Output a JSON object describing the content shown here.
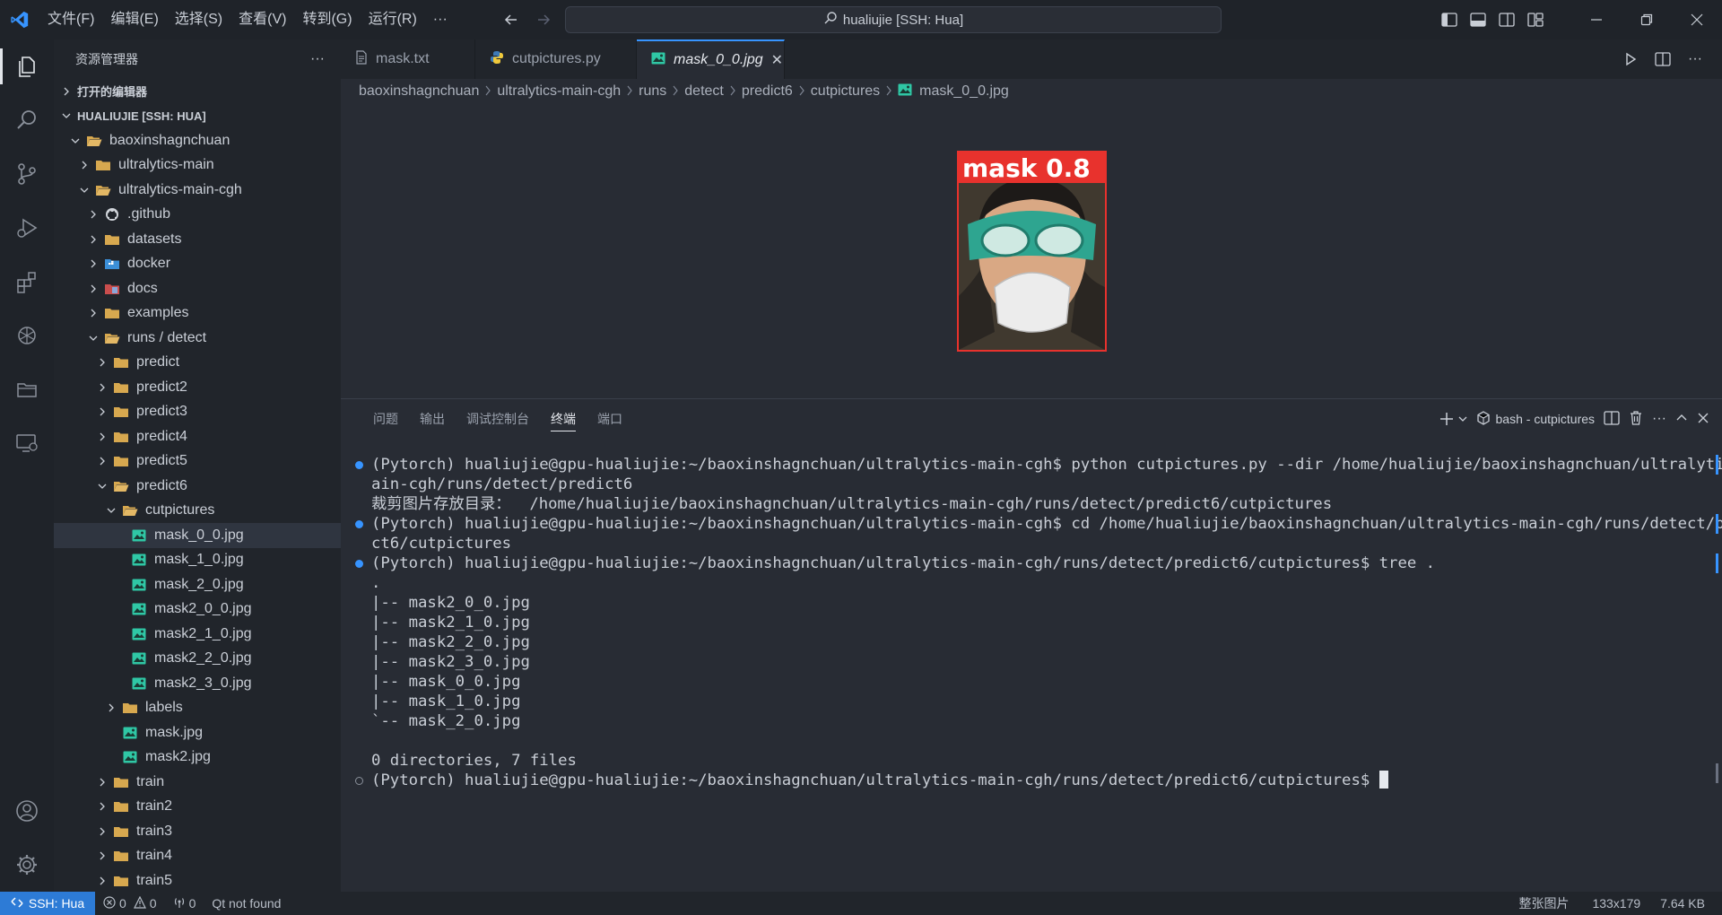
{
  "titlebar": {
    "menu": [
      "文件(F)",
      "编辑(E)",
      "选择(S)",
      "查看(V)",
      "转到(G)",
      "运行(R)",
      "···"
    ],
    "command_center": "hualiujie [SSH: Hua]"
  },
  "sidebar": {
    "title": "资源管理器",
    "more": "···",
    "open_editors": "打开的编辑器",
    "workspace": "HUALIUJIE [SSH: HUA]",
    "tree": [
      {
        "label": "baoxinshagnchuan",
        "depth": 1,
        "kind": "folder",
        "open": true
      },
      {
        "label": "ultralytics-main",
        "depth": 2,
        "kind": "folder",
        "open": false
      },
      {
        "label": "ultralytics-main-cgh",
        "depth": 2,
        "kind": "folder",
        "open": true
      },
      {
        "label": ".github",
        "depth": 3,
        "kind": "github",
        "open": false
      },
      {
        "label": "datasets",
        "depth": 3,
        "kind": "folder",
        "open": false
      },
      {
        "label": "docker",
        "depth": 3,
        "kind": "docker",
        "open": false
      },
      {
        "label": "docs",
        "depth": 3,
        "kind": "docs",
        "open": false
      },
      {
        "label": "examples",
        "depth": 3,
        "kind": "folder",
        "open": false
      },
      {
        "label": "runs / detect",
        "depth": 3,
        "kind": "folder",
        "open": true
      },
      {
        "label": "predict",
        "depth": 4,
        "kind": "folder",
        "open": false
      },
      {
        "label": "predict2",
        "depth": 4,
        "kind": "folder",
        "open": false
      },
      {
        "label": "predict3",
        "depth": 4,
        "kind": "folder",
        "open": false
      },
      {
        "label": "predict4",
        "depth": 4,
        "kind": "folder",
        "open": false
      },
      {
        "label": "predict5",
        "depth": 4,
        "kind": "folder",
        "open": false
      },
      {
        "label": "predict6",
        "depth": 4,
        "kind": "folder",
        "open": true
      },
      {
        "label": "cutpictures",
        "depth": 5,
        "kind": "folder",
        "open": true
      },
      {
        "label": "mask_0_0.jpg",
        "depth": 6,
        "kind": "image",
        "selected": true
      },
      {
        "label": "mask_1_0.jpg",
        "depth": 6,
        "kind": "image"
      },
      {
        "label": "mask_2_0.jpg",
        "depth": 6,
        "kind": "image"
      },
      {
        "label": "mask2_0_0.jpg",
        "depth": 6,
        "kind": "image"
      },
      {
        "label": "mask2_1_0.jpg",
        "depth": 6,
        "kind": "image"
      },
      {
        "label": "mask2_2_0.jpg",
        "depth": 6,
        "kind": "image"
      },
      {
        "label": "mask2_3_0.jpg",
        "depth": 6,
        "kind": "image"
      },
      {
        "label": "labels",
        "depth": 5,
        "kind": "folder",
        "open": false
      },
      {
        "label": "mask.jpg",
        "depth": 5,
        "kind": "image"
      },
      {
        "label": "mask2.jpg",
        "depth": 5,
        "kind": "image"
      },
      {
        "label": "train",
        "depth": 4,
        "kind": "folder",
        "open": false
      },
      {
        "label": "train2",
        "depth": 4,
        "kind": "folder",
        "open": false
      },
      {
        "label": "train3",
        "depth": 4,
        "kind": "folder",
        "open": false
      },
      {
        "label": "train4",
        "depth": 4,
        "kind": "folder",
        "open": false
      },
      {
        "label": "train5",
        "depth": 4,
        "kind": "folder",
        "open": false
      }
    ]
  },
  "editor": {
    "tabs": [
      {
        "label": "mask.txt",
        "icon": "text-file-icon",
        "active": false
      },
      {
        "label": "cutpictures.py",
        "icon": "python-file-icon",
        "active": false
      },
      {
        "label": "mask_0_0.jpg",
        "icon": "image-file-icon",
        "active": true,
        "close": "✕"
      }
    ],
    "breadcrumb": [
      "baoxinshagnchuan",
      "ultralytics-main-cgh",
      "runs",
      "detect",
      "predict6",
      "cutpictures",
      "mask_0_0.jpg"
    ],
    "image_label": "mask 0.8"
  },
  "panel": {
    "tabs": [
      "问题",
      "输出",
      "调试控制台",
      "终端",
      "端口"
    ],
    "active_tab": "终端",
    "terminal_name": "bash - cutpictures",
    "lines": [
      {
        "text": "(Pytorch) hualiujie@gpu-hualiujie:~/baoxinshagnchuan/ultralytics-main-cgh$ python cutpictures.py --dir /home/hualiujie/baoxinshagnchuan/ultralytics-m",
        "dot": "blue"
      },
      {
        "text": "ain-cgh/runs/detect/predict6",
        "dot": ""
      },
      {
        "text": "裁剪图片存放目录：  /home/hualiujie/baoxinshagnchuan/ultralytics-main-cgh/runs/detect/predict6/cutpictures",
        "dot": ""
      },
      {
        "text": "(Pytorch) hualiujie@gpu-hualiujie:~/baoxinshagnchuan/ultralytics-main-cgh$ cd /home/hualiujie/baoxinshagnchuan/ultralytics-main-cgh/runs/detect/predi",
        "dot": "blue"
      },
      {
        "text": "ct6/cutpictures",
        "dot": ""
      },
      {
        "text": "(Pytorch) hualiujie@gpu-hualiujie:~/baoxinshagnchuan/ultralytics-main-cgh/runs/detect/predict6/cutpictures$ tree .",
        "dot": "blue"
      },
      {
        "text": ".",
        "dot": ""
      },
      {
        "text": "|-- mask2_0_0.jpg",
        "dot": ""
      },
      {
        "text": "|-- mask2_1_0.jpg",
        "dot": ""
      },
      {
        "text": "|-- mask2_2_0.jpg",
        "dot": ""
      },
      {
        "text": "|-- mask2_3_0.jpg",
        "dot": ""
      },
      {
        "text": "|-- mask_0_0.jpg",
        "dot": ""
      },
      {
        "text": "|-- mask_1_0.jpg",
        "dot": ""
      },
      {
        "text": "`-- mask_2_0.jpg",
        "dot": ""
      },
      {
        "text": "",
        "dot": ""
      },
      {
        "text": "0 directories, 7 files",
        "dot": ""
      },
      {
        "text": "(Pytorch) hualiujie@gpu-hualiujie:~/baoxinshagnchuan/ultralytics-main-cgh/runs/detect/predict6/cutpictures$ ",
        "dot": "hollow",
        "cursor": true
      }
    ]
  },
  "statusbar": {
    "remote": "SSH: Hua",
    "errors": "0",
    "warnings": "0",
    "ports": "0",
    "message": "Qt not found",
    "zoom": "整张图片",
    "dimensions": "133x179",
    "size": "7.64 KB"
  },
  "colors": {
    "accent": "#3794ff",
    "remote_bg": "#2d7bd6",
    "folder": "#d7a84f",
    "image_icon": "#2fc7a5",
    "bbox": "#e8322d"
  }
}
